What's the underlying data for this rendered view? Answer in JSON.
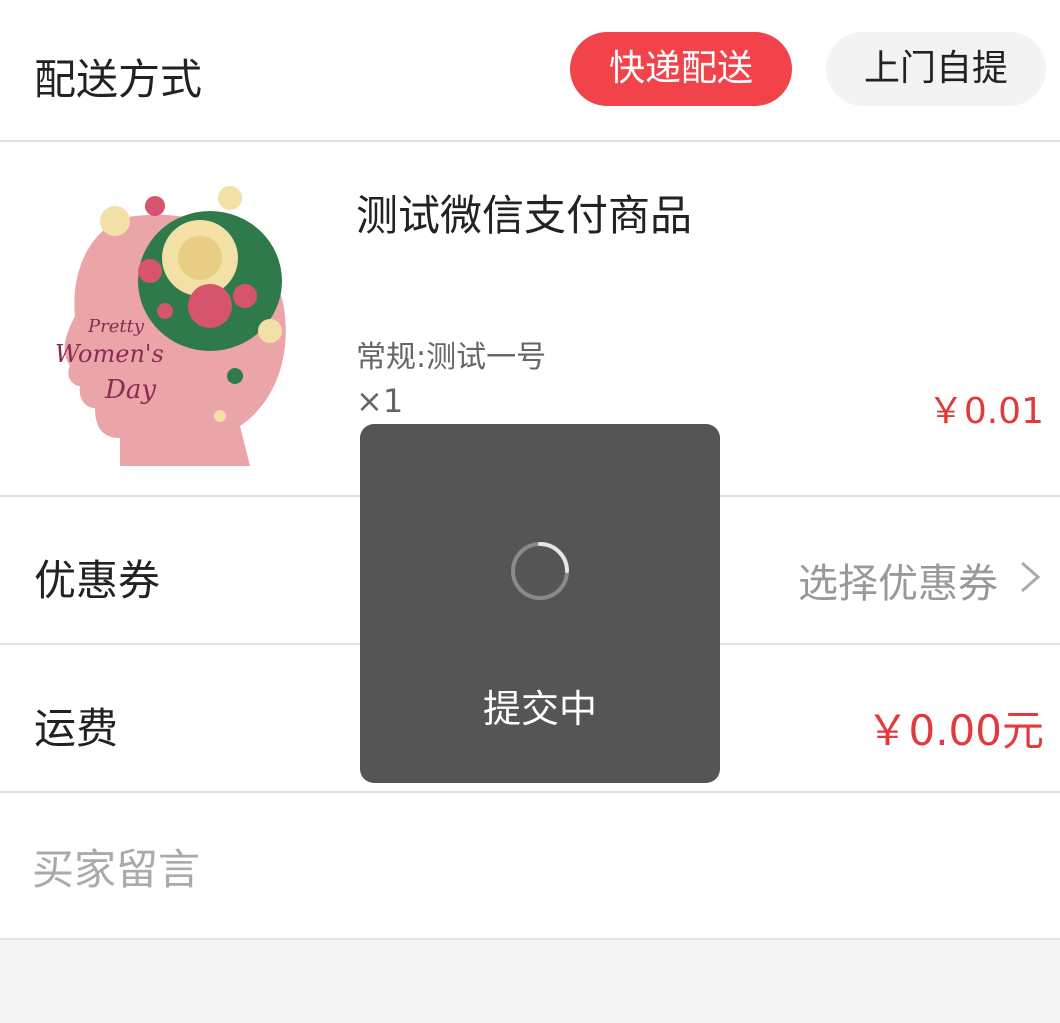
{
  "delivery": {
    "label": "配送方式",
    "options": [
      {
        "label": "快递配送",
        "selected": true
      },
      {
        "label": "上门自提",
        "selected": false
      }
    ]
  },
  "product": {
    "name": "测试微信支付商品",
    "spec": "常规:测试一号",
    "quantity": "×1",
    "price": "￥0.01",
    "image_text": [
      "Pretty",
      "Women's",
      "Day"
    ]
  },
  "coupon": {
    "label": "优惠券",
    "value": "选择优惠券"
  },
  "shipping": {
    "label": "运费",
    "value": "￥0.00元"
  },
  "message": {
    "placeholder": "买家留言",
    "value": ""
  },
  "toast": {
    "text": "提交中"
  },
  "colors": {
    "accent": "#f2434b",
    "price": "#e23a3a"
  }
}
